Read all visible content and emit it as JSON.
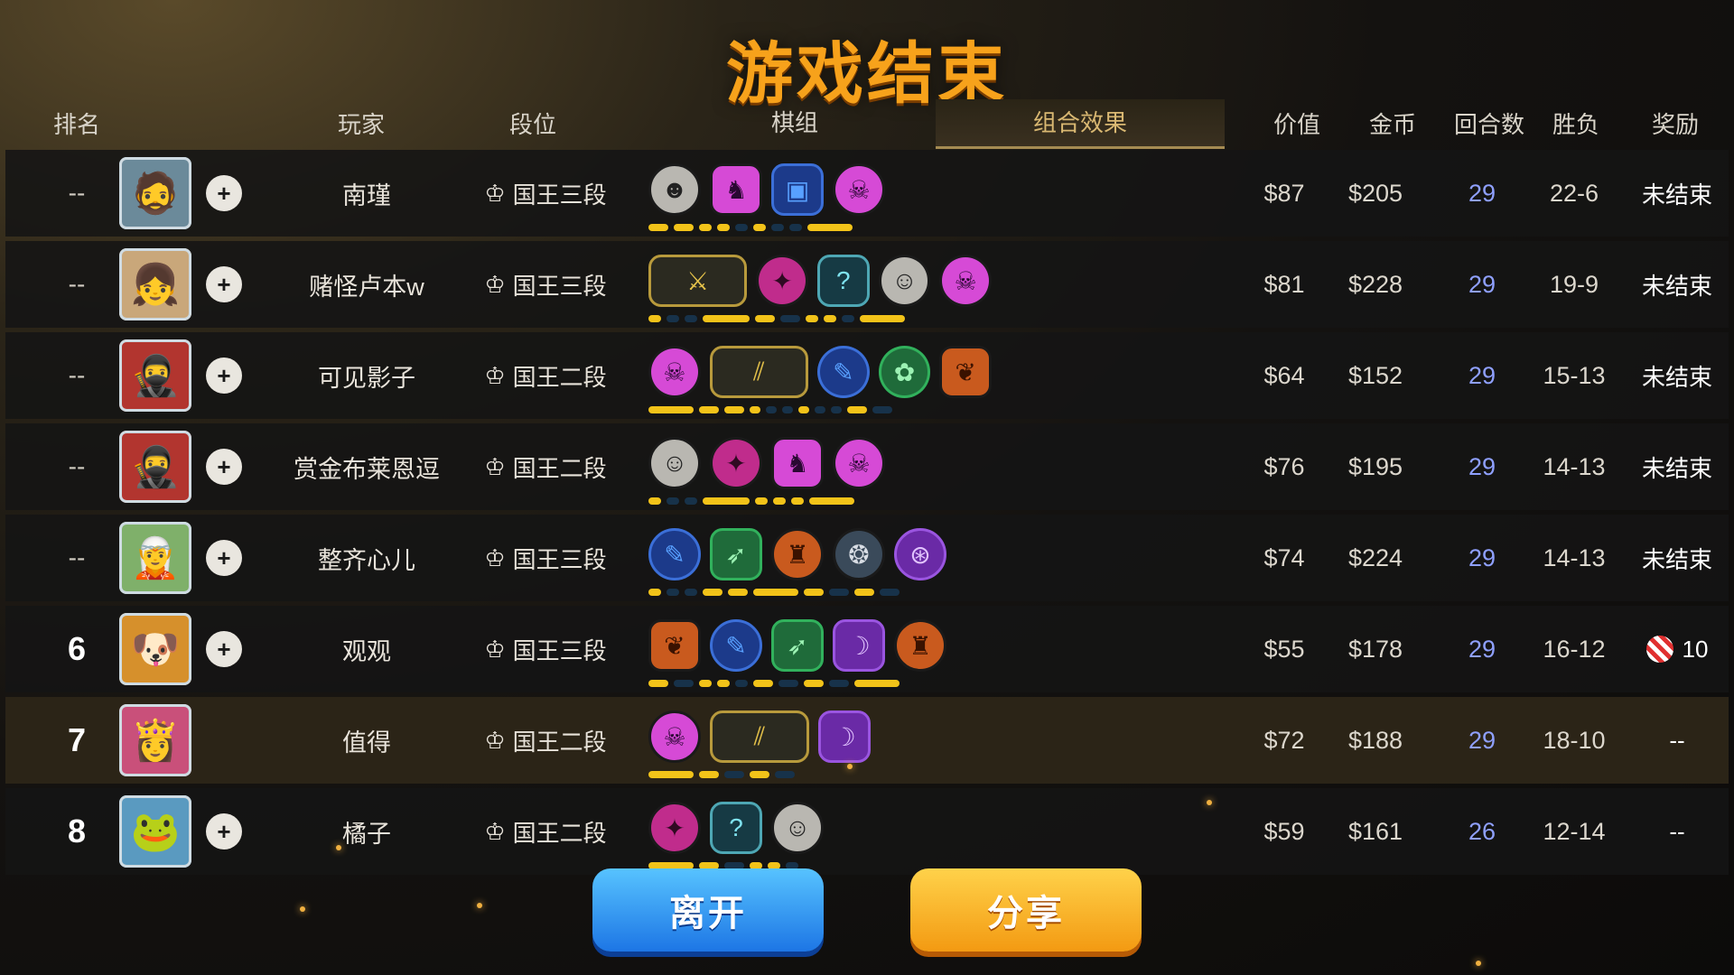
{
  "title": "游戏结束",
  "headers": {
    "rank": "排名",
    "player": "玩家",
    "tier": "段位",
    "board": "棋组",
    "synergy": "组合效果",
    "value": "价值",
    "gold": "金币",
    "rounds": "回合数",
    "win_loss": "胜负",
    "reward": "奖励"
  },
  "rows": [
    {
      "rank": "--",
      "name": "南瑾",
      "tier": "国王三段",
      "value": "$87",
      "gold": "$205",
      "rounds": "29",
      "wl": "22-6",
      "reward": "未结束"
    },
    {
      "rank": "--",
      "name": "赌怪卢本w",
      "tier": "国王三段",
      "value": "$81",
      "gold": "$228",
      "rounds": "29",
      "wl": "19-9",
      "reward": "未结束"
    },
    {
      "rank": "--",
      "name": "可见影子",
      "tier": "国王二段",
      "value": "$64",
      "gold": "$152",
      "rounds": "29",
      "wl": "15-13",
      "reward": "未结束"
    },
    {
      "rank": "--",
      "name": "赏金布莱恩逗",
      "tier": "国王二段",
      "value": "$76",
      "gold": "$195",
      "rounds": "29",
      "wl": "14-13",
      "reward": "未结束"
    },
    {
      "rank": "--",
      "name": "整齐心儿",
      "tier": "国王三段",
      "value": "$74",
      "gold": "$224",
      "rounds": "29",
      "wl": "14-13",
      "reward": "未结束"
    },
    {
      "rank": "6",
      "name": "观观",
      "tier": "国王三段",
      "value": "$55",
      "gold": "$178",
      "rounds": "29",
      "wl": "16-12",
      "reward": "10"
    },
    {
      "rank": "7",
      "name": "值得",
      "tier": "国王二段",
      "value": "$72",
      "gold": "$188",
      "rounds": "29",
      "wl": "18-10",
      "reward": "--"
    },
    {
      "rank": "8",
      "name": "橘子",
      "tier": "国王二段",
      "value": "$59",
      "gold": "$161",
      "rounds": "26",
      "wl": "12-14",
      "reward": "--"
    }
  ],
  "buttons": {
    "leave": "离开",
    "share": "分享"
  },
  "colors": {
    "title": "#f7a21b",
    "synergy_bar_on": "#f2c319",
    "rounds": "#8fa0ff"
  }
}
